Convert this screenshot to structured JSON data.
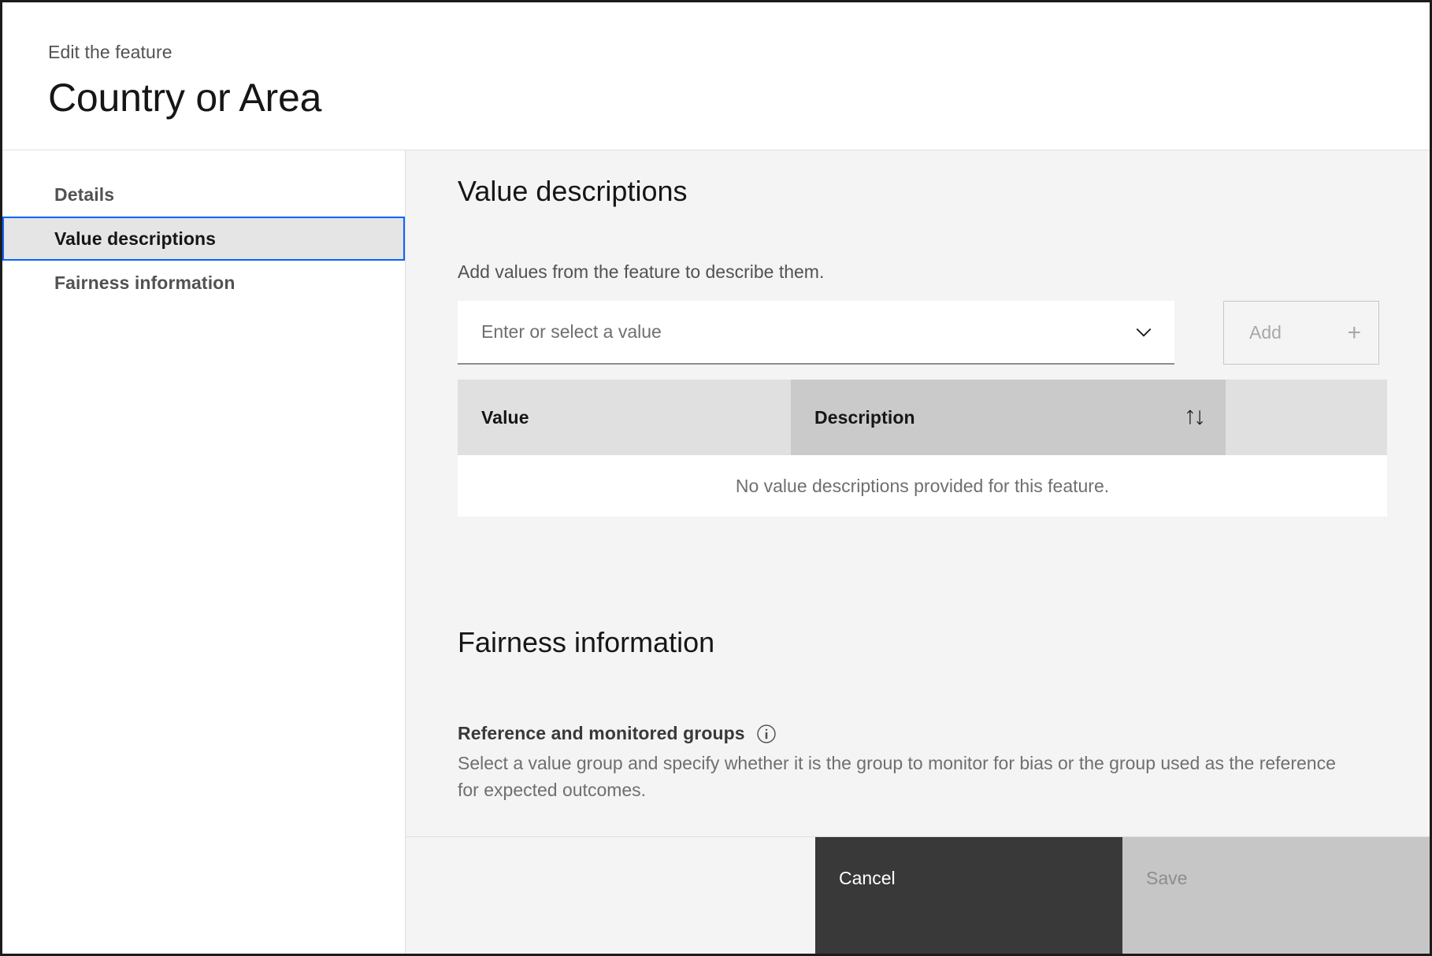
{
  "header": {
    "eyebrow": "Edit the feature",
    "title": "Country or Area"
  },
  "sidebar": {
    "items": [
      {
        "label": "Details",
        "selected": false
      },
      {
        "label": "Value descriptions",
        "selected": true
      },
      {
        "label": "Fairness information",
        "selected": false
      }
    ]
  },
  "main": {
    "value_descriptions": {
      "heading": "Value descriptions",
      "helper_text": "Add values from the feature to describe them.",
      "combobox": {
        "placeholder": "Enter or select a value",
        "value": "",
        "chevron_icon": "chevron-down-icon"
      },
      "add_button": {
        "label": "Add",
        "icon": "plus-icon",
        "disabled": true
      },
      "table": {
        "columns": [
          "Value",
          "Description",
          ""
        ],
        "sort_icon": "sort-ascending-descending-icon",
        "sorted_column": "Description",
        "rows": [],
        "empty_message": "No value descriptions provided for this feature."
      }
    },
    "fairness_information": {
      "heading": "Fairness information",
      "subsection": {
        "title": "Reference and monitored groups",
        "info_icon": "information-icon",
        "description": "Select a value group and specify whether it is the group to monitor for bias or the group used as the reference for expected outcomes."
      }
    }
  },
  "footer": {
    "cancel_label": "Cancel",
    "save_label": "Save",
    "save_disabled": true
  },
  "colors": {
    "focus_blue": "#0f62fe",
    "selected_bg": "#e5e5e5",
    "panel_bg": "#f4f4f4",
    "table_header_bg": "#e0e0e0",
    "table_header_hover_bg": "#cacaca",
    "cancel_bg": "#393939",
    "save_disabled_bg": "#c6c6c6"
  }
}
